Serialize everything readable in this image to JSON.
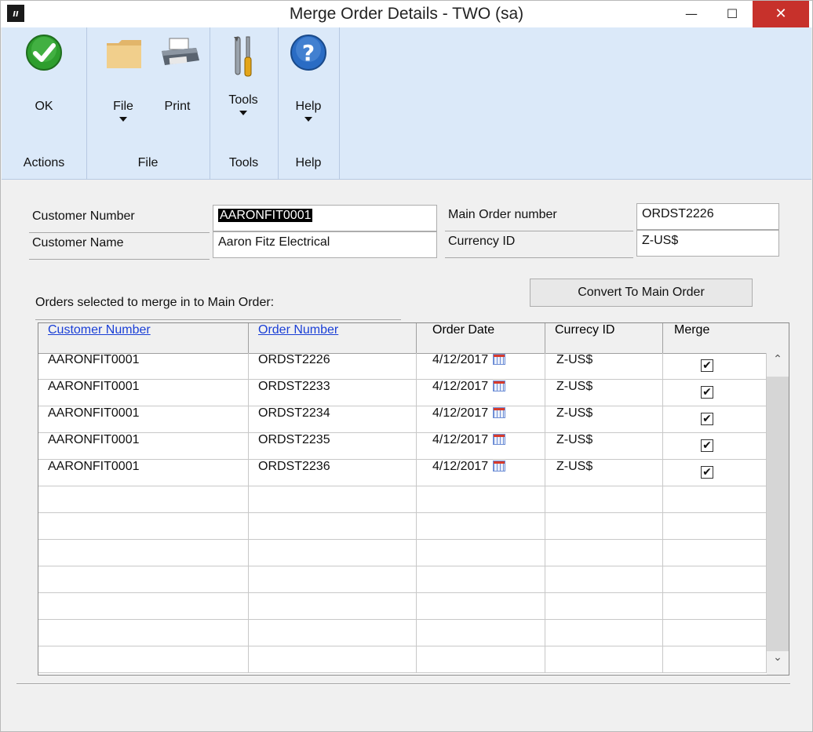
{
  "window": {
    "title": "Merge Order Details  -  TWO (sa)"
  },
  "ribbon": {
    "groups": [
      {
        "label": "Actions",
        "tools": [
          {
            "label": "OK",
            "icon": "ok-check-icon"
          }
        ]
      },
      {
        "label": "File",
        "tools": [
          {
            "label": "File",
            "icon": "folder-icon",
            "dropdown": true
          },
          {
            "label": "Print",
            "icon": "printer-icon"
          }
        ]
      },
      {
        "label": "Tools",
        "tools": [
          {
            "label": "Tools",
            "icon": "tools-icon",
            "dropdown": true
          }
        ]
      },
      {
        "label": "Help",
        "tools": [
          {
            "label": "Help",
            "icon": "help-icon",
            "dropdown": true
          }
        ]
      }
    ]
  },
  "form": {
    "customer_number_label": "Customer Number",
    "customer_number_value": "AARONFIT0001",
    "customer_name_label": "Customer Name",
    "customer_name_value": "Aaron Fitz Electrical",
    "main_order_label": "Main Order number",
    "main_order_value": "ORDST2226",
    "currency_label": "Currency ID",
    "currency_value": "Z-US$",
    "convert_button": "Convert To  Main Order",
    "orders_caption": "Orders selected to merge in to Main Order:"
  },
  "grid": {
    "columns": [
      "Customer Number",
      "Order Number",
      "Order Date",
      "Currecy ID",
      "Merge"
    ],
    "rows": [
      {
        "customer": "AARONFIT0001",
        "order": "ORDST2226",
        "date": "4/12/2017",
        "currency": "Z-US$",
        "merge": "✔"
      },
      {
        "customer": "AARONFIT0001",
        "order": "ORDST2233",
        "date": "4/12/2017",
        "currency": "Z-US$",
        "merge": "✔"
      },
      {
        "customer": "AARONFIT0001",
        "order": "ORDST2234",
        "date": "4/12/2017",
        "currency": "Z-US$",
        "merge": "✔"
      },
      {
        "customer": "AARONFIT0001",
        "order": "ORDST2235",
        "date": "4/12/2017",
        "currency": "Z-US$",
        "merge": "✔"
      },
      {
        "customer": "AARONFIT0001",
        "order": "ORDST2236",
        "date": "4/12/2017",
        "currency": "Z-US$",
        "merge": "✔"
      }
    ]
  },
  "colors": {
    "ribbon": "#dbe9f9",
    "close": "#c7312b",
    "link": "#1a3fd6",
    "ok_green": "#2e9e2e",
    "help_blue": "#2a6cc4"
  }
}
